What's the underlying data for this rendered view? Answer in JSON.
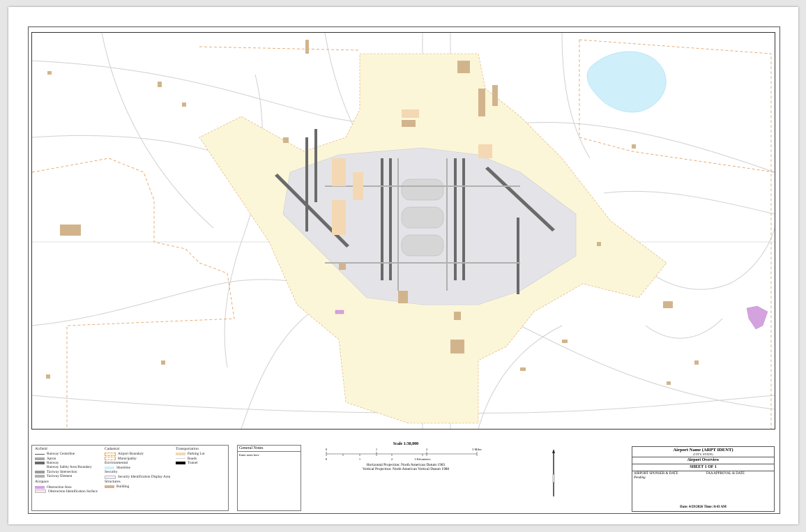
{
  "legend": {
    "airfield": {
      "heading": "Airfield",
      "items": [
        {
          "label": "Runway Centerline",
          "color": "#555555",
          "style": "line"
        },
        {
          "label": "Apron",
          "color": "#a8a8a8",
          "style": "fill"
        },
        {
          "label": "Runway",
          "color": "#6a6a6a",
          "style": "fill"
        },
        {
          "label": "Runway Safety Area Boundary",
          "color": "#ffffff",
          "style": "none"
        },
        {
          "label": "Taxiway Intersection",
          "color": "#9c9c9c",
          "style": "fill"
        },
        {
          "label": "Taxiway Element",
          "color": "#b0b0b0",
          "style": "fill"
        }
      ]
    },
    "airspace": {
      "heading": "Airspace",
      "items": [
        {
          "label": "Obstruction Area",
          "color": "#d4a3df",
          "style": "fill"
        },
        {
          "label": "Obstruction Identification Surface",
          "color": "#fde8ec",
          "style": "outline"
        }
      ]
    },
    "cadastral": {
      "heading": "Cadastral",
      "items": [
        {
          "label": "Airport Boundary",
          "color": "#fbf6d8",
          "style": "dashed"
        },
        {
          "label": "Municipality",
          "color": "#ffffff",
          "style": "dashed"
        }
      ]
    },
    "environmental": {
      "heading": "Environmental",
      "items": [
        {
          "label": "Shoreline",
          "color": "#cfeffb",
          "style": "fill"
        }
      ]
    },
    "security": {
      "heading": "Security",
      "items": [
        {
          "label": "Security Identification Display Area",
          "color": "#eeeeff",
          "style": "outline"
        }
      ]
    },
    "structures": {
      "heading": "Structures",
      "items": [
        {
          "label": "Building",
          "color": "#d2b48c",
          "style": "fill"
        }
      ]
    },
    "transportation": {
      "heading": "Transportation",
      "items": [
        {
          "label": "Parking Lot",
          "color": "#f3d8b3",
          "style": "fill"
        },
        {
          "label": "Roads",
          "color": "#cfcfcf",
          "style": "line"
        },
        {
          "label": "Tunnel",
          "color": "#000000",
          "style": "fill"
        }
      ]
    }
  },
  "notes": {
    "heading": "General Notes",
    "body": "Enter notes here"
  },
  "scale": {
    "title": "Scale 1:30,000",
    "miles_ticks": [
      "0",
      "1",
      "2",
      "3 Miles"
    ],
    "km_ticks": [
      "0",
      "1",
      "2",
      "3 Kilometers"
    ],
    "horizontal": "Horizontal Projection: North American Datum 1983",
    "vertical": "Vertical Projection: North American Vertical Datum 1988"
  },
  "titleblock": {
    "airport": "Airport Name (ARPT IDENT)",
    "city_state": "(CITY, STATE)",
    "sheet_name": "Airport Overview",
    "sheet": "SHEET 1 OF 1",
    "sponsor_label": "AIRPORT SPONSER & DATE",
    "faa_label": "FAA APPROVAL & DATE",
    "status": "Pending",
    "date": "Date: 4/29/2026   Time: 8:43 AM"
  },
  "colors": {
    "airport_area": "#fbf6d8",
    "water": "#cfeffb",
    "building": "#d2b48c",
    "parking": "#f3d8b3",
    "apron": "#dcdcdc",
    "runway": "#6a6a6a",
    "road": "#cfcfcf",
    "boundary": "#e3a46a",
    "obstruction": "#d4a3df"
  }
}
